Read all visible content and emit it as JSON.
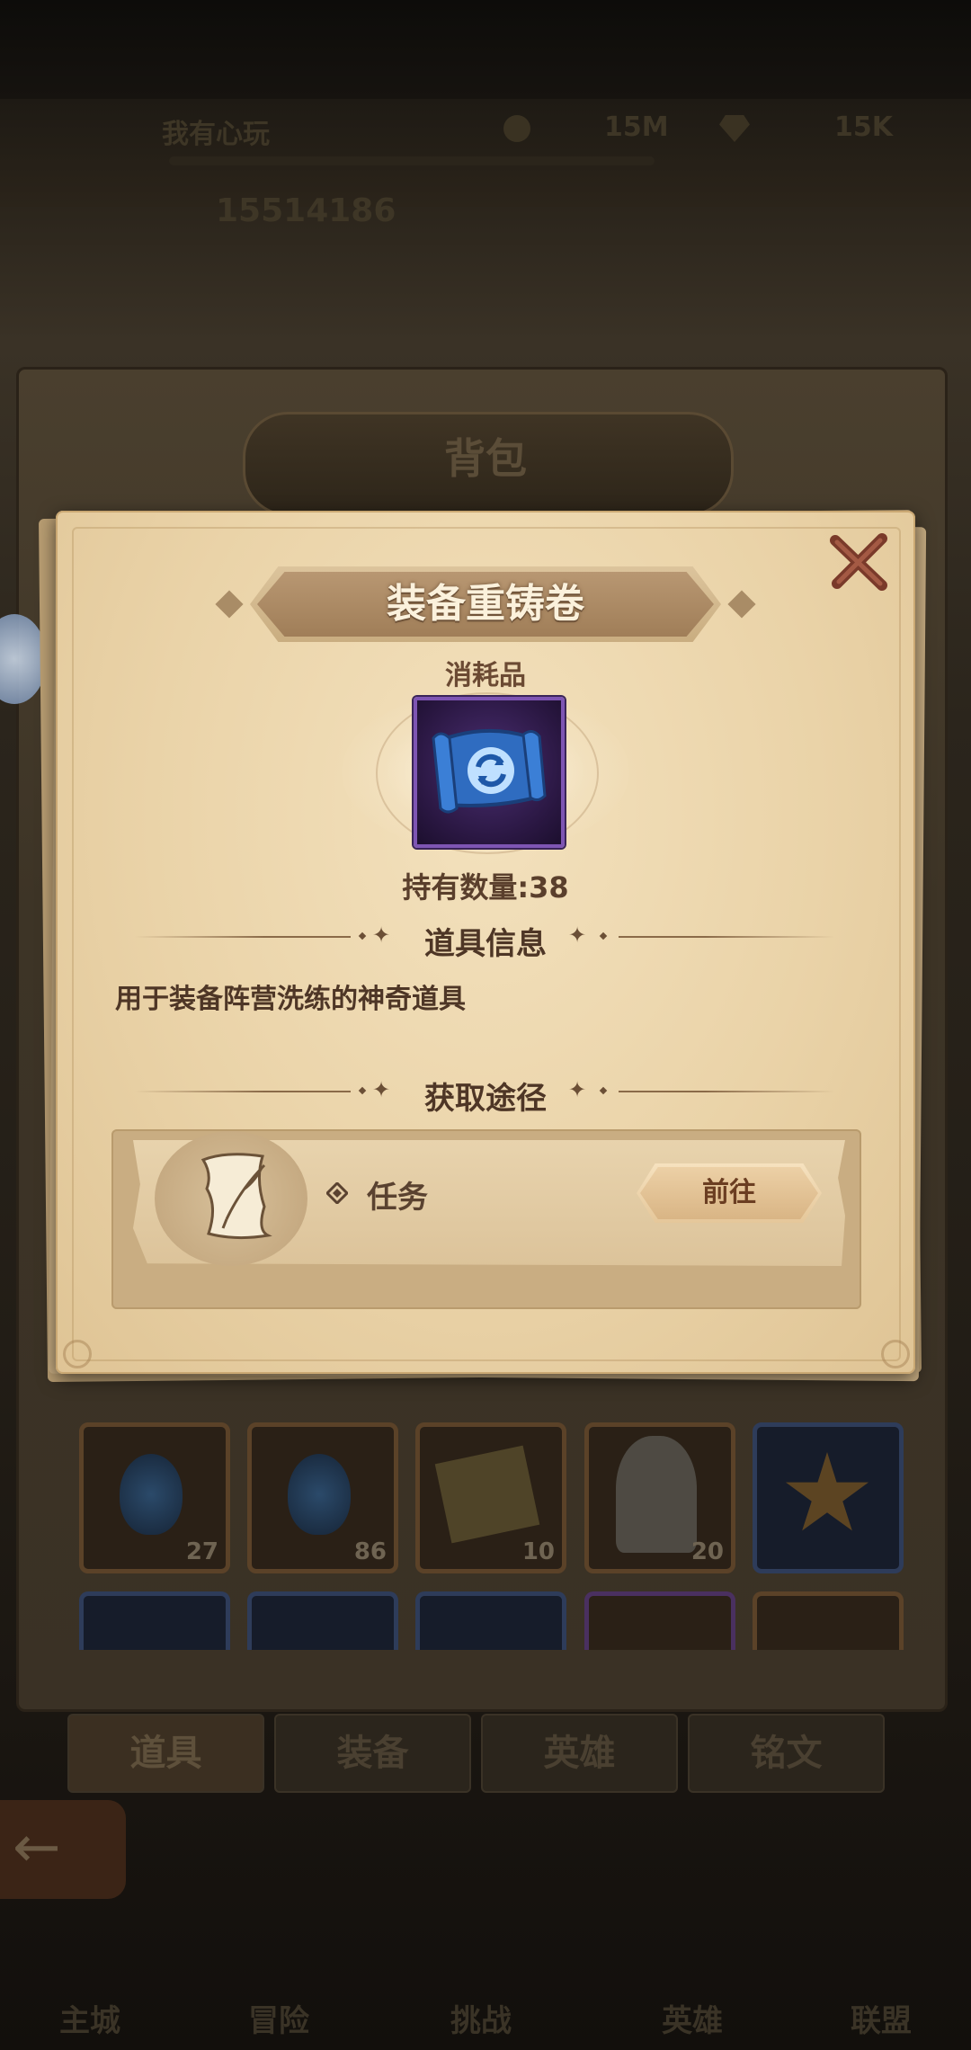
{
  "hud": {
    "player_name": "我有心玩",
    "gold": "15M",
    "gems": "15K",
    "power": "15514186"
  },
  "bag": {
    "title": "背包",
    "tabs": [
      {
        "label": "道具",
        "active": true
      },
      {
        "label": "装备",
        "active": false
      },
      {
        "label": "英雄",
        "active": false
      },
      {
        "label": "铭文",
        "active": false
      }
    ],
    "grid_row1": [
      {
        "icon": "blue-flame-icon",
        "count": "27"
      },
      {
        "icon": "blue-flame-icon",
        "count": "86"
      },
      {
        "icon": "scroll-paper-icon",
        "count": "10"
      },
      {
        "icon": "hero-portrait-icon",
        "count": "20"
      },
      {
        "icon": "star-crystal-icon",
        "count": ""
      }
    ]
  },
  "bottom_nav": [
    "主城",
    "冒险",
    "挑战",
    "英雄",
    "联盟"
  ],
  "dialog": {
    "title": "装备重铸卷",
    "category": "消耗品",
    "item_icon": "recast-scroll-icon",
    "quantity": "持有数量:38",
    "info_section_title": "道具信息",
    "description": "用于装备阵营洗练的神奇道具",
    "source_section_title": "获取途径",
    "sources": [
      {
        "icon": "quest-scroll-icon",
        "label": "任务",
        "button_label": "前往"
      }
    ]
  },
  "colors": {
    "dialog_parchment": "#ead3a8",
    "title_text": "#fbf1dc",
    "item_frame_purple": "#7e55b3",
    "goto_button": "#e5c79a"
  }
}
